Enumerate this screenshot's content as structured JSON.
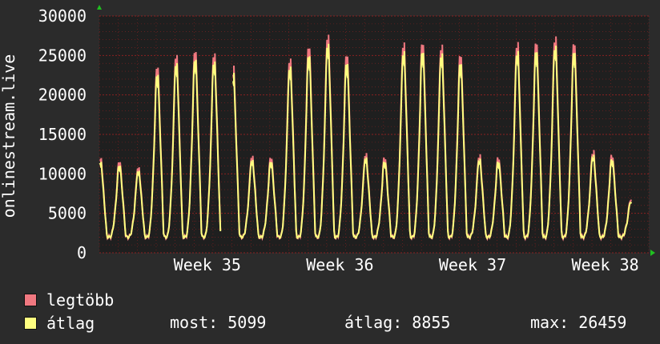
{
  "chart_data": {
    "type": "line",
    "ylabel": "onlinestream.live",
    "ylim": [
      0,
      30000
    ],
    "yticks": [
      "0",
      "5000",
      "10000",
      "15000",
      "20000",
      "25000",
      "30000"
    ],
    "xticks": [
      "Week 35",
      "Week 36",
      "Week 37",
      "Week 38"
    ],
    "grid": true,
    "days": 29,
    "daily_peaks": [
      12000,
      11500,
      10800,
      23500,
      25000,
      25500,
      25200,
      23800,
      12200,
      12000,
      24500,
      26000,
      27500,
      25000,
      12500,
      12000,
      26500,
      26500,
      26200,
      25000,
      12300,
      12000,
      26500,
      26600,
      27200,
      26500,
      12800,
      12300,
      6800
    ],
    "baseline": 2000,
    "gap_day": 7,
    "series": [
      {
        "name": "legtöbb",
        "color": "#f07880"
      },
      {
        "name": "átlag",
        "color": "#ffff80"
      }
    ]
  },
  "legend": {
    "max_label": "legtöbb",
    "avg_label": "átlag",
    "stats": {
      "most": "most: 5099",
      "atlag": "átlag: 8855",
      "max": "max: 26459"
    }
  },
  "colors": {
    "background": "#2b2b2b",
    "plot_bg": "#1f1f1f",
    "grid": "#8b2020",
    "max_series": "#f07880",
    "avg_series": "#ffff80",
    "axis_arrow": "#20c020"
  }
}
